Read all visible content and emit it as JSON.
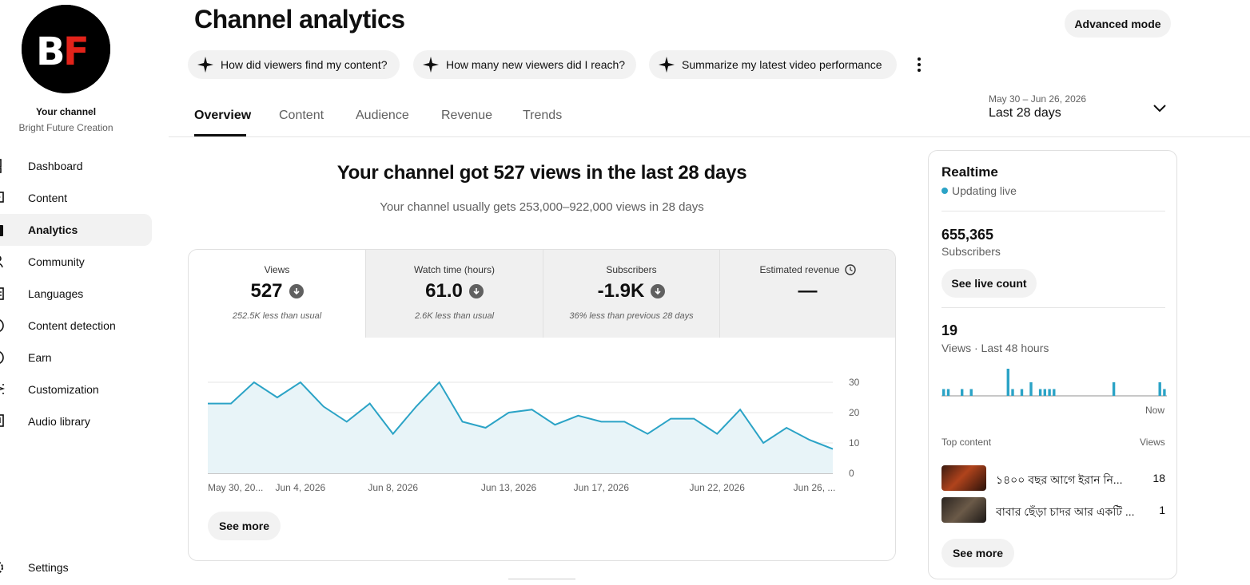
{
  "sidebar": {
    "channel_label": "Your channel",
    "channel_name": "Bright Future Creation",
    "logo_text": "BF",
    "items": [
      {
        "label": "Dashboard",
        "icon": "dashboard-icon"
      },
      {
        "label": "Content",
        "icon": "content-icon"
      },
      {
        "label": "Analytics",
        "icon": "analytics-icon",
        "active": true
      },
      {
        "label": "Community",
        "icon": "community-icon"
      },
      {
        "label": "Languages",
        "icon": "languages-icon"
      },
      {
        "label": "Content detection",
        "icon": "content-detection-icon"
      },
      {
        "label": "Earn",
        "icon": "earn-icon"
      },
      {
        "label": "Customization",
        "icon": "customization-icon"
      },
      {
        "label": "Audio library",
        "icon": "audio-library-icon"
      }
    ],
    "settings_label": "Settings"
  },
  "header": {
    "title": "Channel analytics",
    "advanced_mode": "Advanced mode",
    "prompts": [
      "How did viewers find my content?",
      "How many new viewers did I reach?",
      "Summarize my latest video performance"
    ],
    "tabs": [
      "Overview",
      "Content",
      "Audience",
      "Revenue",
      "Trends"
    ],
    "date_range": "May 30 – Jun 26, 2026",
    "date_label": "Last 28 days"
  },
  "main": {
    "headline": "Your channel got 527 views in the last 28 days",
    "subline": "Your channel usually gets 253,000–922,000 views in 28 days",
    "metrics": [
      {
        "label": "Views",
        "value": "527",
        "note": "252.5K less than usual"
      },
      {
        "label": "Watch time (hours)",
        "value": "61.0",
        "note": "2.6K less than usual"
      },
      {
        "label": "Subscribers",
        "value": "-1.9K",
        "note": "36% less than previous 28 days"
      },
      {
        "label": "Estimated revenue",
        "value": "—",
        "note": ""
      }
    ],
    "see_more": "See more"
  },
  "chart_data": {
    "type": "area",
    "x": [
      "May 30",
      "May 31",
      "Jun 1",
      "Jun 2",
      "Jun 3",
      "Jun 4",
      "Jun 5",
      "Jun 6",
      "Jun 7",
      "Jun 8",
      "Jun 9",
      "Jun 10",
      "Jun 11",
      "Jun 12",
      "Jun 13",
      "Jun 14",
      "Jun 15",
      "Jun 16",
      "Jun 17",
      "Jun 18",
      "Jun 19",
      "Jun 20",
      "Jun 21",
      "Jun 22",
      "Jun 23",
      "Jun 24",
      "Jun 25",
      "Jun 26"
    ],
    "series": [
      {
        "values": [
          23,
          23,
          30,
          25,
          30,
          22,
          17,
          23,
          13,
          22,
          30,
          17,
          15,
          20,
          21,
          16,
          19,
          17,
          17,
          13,
          18,
          18,
          13,
          21,
          10,
          15,
          11,
          8
        ]
      }
    ],
    "tick_labels": [
      "May 30, 20...",
      "Jun 4, 2026",
      "Jun 8, 2026",
      "Jun 13, 2026",
      "Jun 17, 2026",
      "Jun 22, 2026",
      "Jun 26, ..."
    ],
    "tick_index": [
      0,
      4,
      8,
      13,
      17,
      22,
      26
    ],
    "yticks": [
      0,
      10,
      20,
      30
    ],
    "ylim": [
      0,
      30
    ],
    "grid": true,
    "color": "#2ba3c6"
  },
  "realtime": {
    "title": "Realtime",
    "status": "Updating live",
    "subscribers_value": "655,365",
    "subscribers_label": "Subscribers",
    "live_count_button": "See live count",
    "views_value": "19",
    "views_label": "Views · Last 48 hours",
    "now_label": "Now",
    "bars": [
      1,
      1,
      0,
      0,
      1,
      0,
      1,
      0,
      0,
      0,
      0,
      0,
      0,
      0,
      4,
      1,
      0,
      1,
      0,
      2,
      0,
      1,
      1,
      1,
      1,
      0,
      0,
      0,
      0,
      0,
      0,
      0,
      0,
      0,
      0,
      0,
      0,
      2,
      0,
      0,
      0,
      0,
      0,
      0,
      0,
      0,
      0,
      2,
      1
    ],
    "top_content_label": "Top content",
    "views_col_label": "Views",
    "top_content": [
      {
        "title": "১৪০০ বছর আগে ইরান নি...",
        "views": "18"
      },
      {
        "title": "বাবার ছেঁড়া চাদর আর একটি ...",
        "views": "1"
      }
    ],
    "see_more": "See more"
  },
  "colors": {
    "accent": "#2ba3c6",
    "logo_red": "#e2231a",
    "status_dot": "#2ba3c6"
  }
}
